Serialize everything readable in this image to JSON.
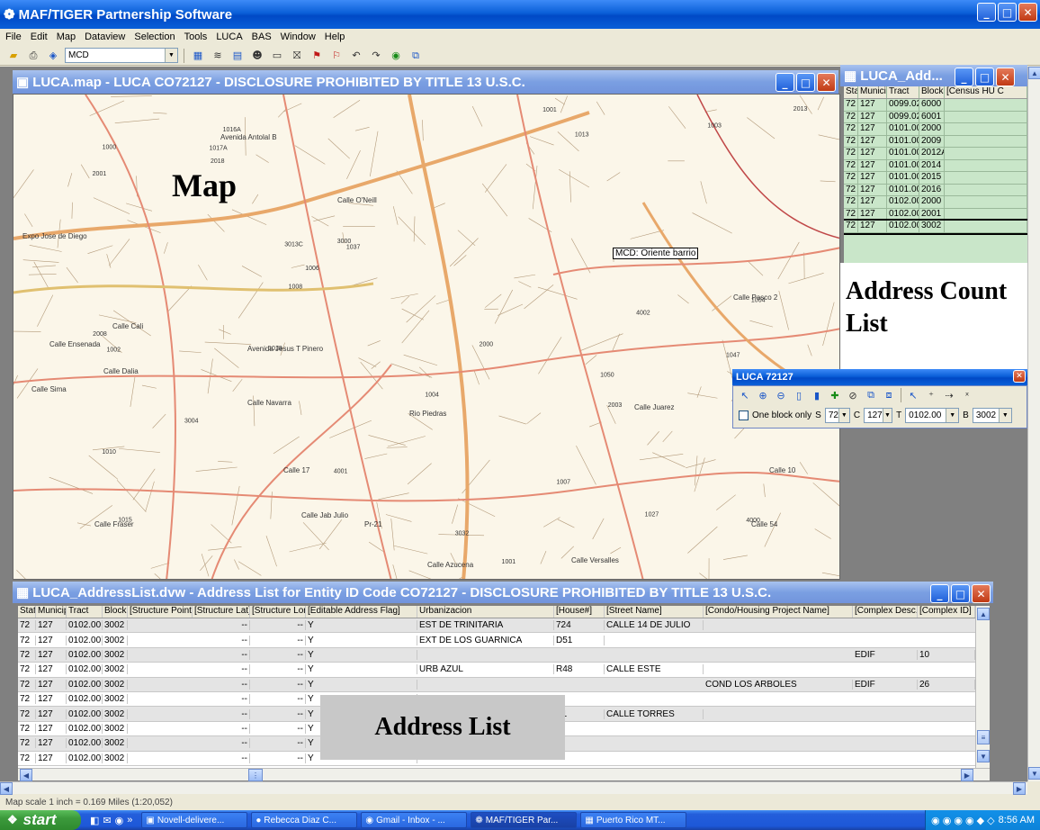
{
  "app": {
    "title": "MAF/TIGER Partnership Software"
  },
  "menu": [
    "File",
    "Edit",
    "Map",
    "Dataview",
    "Selection",
    "Tools",
    "LUCA",
    "BAS",
    "Window",
    "Help"
  ],
  "toolbar": {
    "layer_select": "MCD"
  },
  "map_window": {
    "title": "LUCA.map - LUCA CO72127 - DISCLOSURE PROHIBITED BY TITLE 13 U.S.C.",
    "overlay_label": "Map",
    "tooltip": "MCD: Oriente barrio",
    "street_labels": [
      "Avenida Antolal B",
      "Calle O'Neill",
      "Expo Jose de Diego",
      "Calle Cali",
      "Calle Ensenada",
      "Calle Dalia",
      "Calle Sima",
      "Avenida Jesus T Pinero",
      "Calle Navarra",
      "Calle Fraser",
      "Calle Azucena",
      "Calle Versalles",
      "Calle Pasco 2",
      "Calle 10",
      "Calle 54",
      "Calle Juarez",
      "Rio Piedras",
      "Calle 17",
      "Calle Jab Julio",
      "Pr-21"
    ],
    "block_numbers": [
      "1050",
      "1047",
      "1015",
      "1016A",
      "1037",
      "1027",
      "1010",
      "1013",
      "3013C",
      "1001",
      "2001",
      "2008",
      "1000",
      "4000",
      "4001",
      "1004",
      "1004",
      "2000",
      "3000",
      "3004",
      "2013",
      "1003",
      "1008",
      "6999",
      "1001",
      "1017A",
      "2003",
      "1002",
      "2018",
      "4002",
      "3032",
      "1007",
      "1006",
      "1018"
    ]
  },
  "luca_list_window": {
    "title": "LUCA_Add...",
    "columns": [
      "State",
      "Municipio",
      "Tract",
      "Block",
      "[Census HU C"
    ],
    "rows": [
      [
        "72",
        "127",
        "0099.02",
        "6000",
        ""
      ],
      [
        "72",
        "127",
        "0099.02",
        "6001",
        ""
      ],
      [
        "72",
        "127",
        "0101.00",
        "2000",
        ""
      ],
      [
        "72",
        "127",
        "0101.00",
        "2009",
        ""
      ],
      [
        "72",
        "127",
        "0101.00",
        "2012A",
        ""
      ],
      [
        "72",
        "127",
        "0101.00",
        "2014",
        ""
      ],
      [
        "72",
        "127",
        "0101.00",
        "2015",
        ""
      ],
      [
        "72",
        "127",
        "0101.00",
        "2016",
        ""
      ],
      [
        "72",
        "127",
        "0102.00",
        "2000",
        ""
      ],
      [
        "72",
        "127",
        "0102.00",
        "2001",
        ""
      ],
      [
        "72",
        "127",
        "0102.00",
        "3002",
        ""
      ]
    ],
    "overlay_label": "Address Count List"
  },
  "luca_toolbox": {
    "title": "LUCA 72127",
    "one_block_label": "One block only",
    "s_label": "S",
    "s_value": "72",
    "c_label": "C",
    "c_value": "127",
    "t_label": "T",
    "t_value": "0102.00",
    "b_label": "B",
    "b_value": "3002"
  },
  "address_list_window": {
    "title": "LUCA_AddressList.dvw - Address List for Entity ID Code CO72127 - DISCLOSURE PROHIBITED BY TITLE 13 U.S.C.",
    "columns": [
      "State",
      "Municipio",
      "Tract",
      "Block",
      "[Structure Point]",
      "[Structure Lat]",
      "[Structure Lon]",
      "[Editable Address Flag]",
      "Urbanizacion",
      "[House#]",
      "[Street Name]",
      "[Condo/Housing Project Name]",
      "[Complex Desc.]",
      "[Complex ID]"
    ],
    "rows": [
      [
        "72",
        "127",
        "0102.00",
        "3002",
        "",
        "--",
        "--",
        "Y",
        "EST DE TRINITARIA",
        "724",
        "CALLE 14 DE JULIO",
        "",
        "",
        ""
      ],
      [
        "72",
        "127",
        "0102.00",
        "3002",
        "",
        "--",
        "--",
        "Y",
        "EXT DE LOS GUARNICA",
        "D51",
        "",
        "",
        "",
        ""
      ],
      [
        "72",
        "127",
        "0102.00",
        "3002",
        "",
        "--",
        "--",
        "Y",
        "",
        "",
        "",
        "",
        "EDIF",
        "10"
      ],
      [
        "72",
        "127",
        "0102.00",
        "3002",
        "",
        "--",
        "--",
        "Y",
        "URB AZUL",
        "R48",
        "CALLE ESTE",
        "",
        "",
        ""
      ],
      [
        "72",
        "127",
        "0102.00",
        "3002",
        "",
        "--",
        "--",
        "Y",
        "",
        "",
        "",
        "COND LOS ARBOLES",
        "EDIF",
        "26"
      ],
      [
        "72",
        "127",
        "0102.00",
        "3002",
        "",
        "--",
        "--",
        "Y",
        "",
        "",
        "",
        "",
        "",
        ""
      ],
      [
        "72",
        "127",
        "0102.00",
        "3002",
        "",
        "--",
        "--",
        "Y",
        "",
        "A1",
        "CALLE TORRES",
        "",
        "",
        ""
      ],
      [
        "72",
        "127",
        "0102.00",
        "3002",
        "",
        "--",
        "--",
        "Y",
        "",
        "",
        "",
        "",
        "",
        ""
      ],
      [
        "72",
        "127",
        "0102.00",
        "3002",
        "",
        "--",
        "--",
        "Y",
        "",
        "",
        "",
        "",
        "",
        ""
      ],
      [
        "72",
        "127",
        "0102.00",
        "3002",
        "",
        "--",
        "--",
        "Y",
        "",
        "",
        "",
        "",
        "",
        ""
      ]
    ],
    "overlay_label": "Address List"
  },
  "status_bar": {
    "text": "Map scale 1 inch = 0.169 Miles (1:20,052)"
  },
  "taskbar": {
    "start_label": "start",
    "tasks": [
      "Novell-delivere...",
      "Rebecca Diaz C...",
      "Gmail - Inbox - ...",
      "MAF/TIGER Par...",
      "Puerto Rico MT..."
    ],
    "active_task_index": 3,
    "clock": "8:56 AM"
  }
}
